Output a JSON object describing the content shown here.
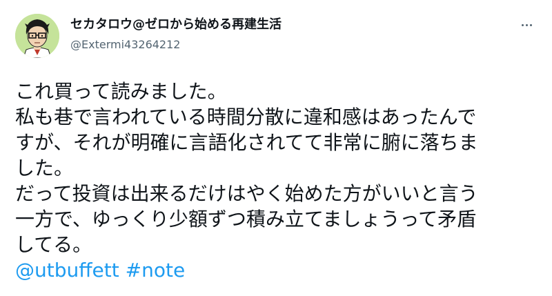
{
  "tweet": {
    "author": {
      "display_name": "セカタロウ@ゼロから始める再建生活",
      "handle": "@Extermi43264212"
    },
    "text_lines": [
      "これ買って読みました。",
      "私も巷で言われている時間分散に違和感はあったんで",
      "すが、それが明確に言語化されてて非常に腑に落ちま",
      "した。",
      "だって投資は出来るだけはやく始めた方がいいと言う",
      "一方で、ゆっくり少額ずつ積み立てましょうって矛盾",
      "してる。"
    ],
    "mention": "@utbuffett",
    "hashtag": "#note",
    "colors": {
      "link": "#1d9bf0",
      "text": "#0f1419",
      "secondary": "#536471",
      "avatar_bg": "#c5e39a"
    },
    "icons": {
      "more": "more-horizontal-icon"
    }
  }
}
